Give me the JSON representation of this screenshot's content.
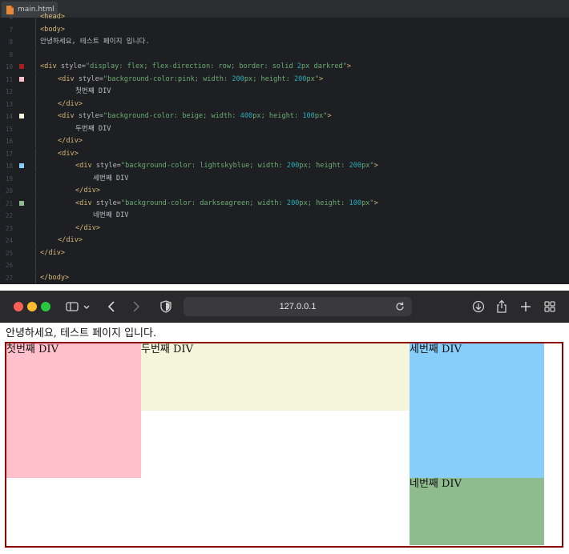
{
  "editor": {
    "tab": {
      "label": "main.html"
    },
    "lines": [
      {
        "n": "6",
        "text": "<head>",
        "partial": true
      },
      {
        "n": "7",
        "text": "<body>"
      },
      {
        "n": "8",
        "text": "안녕하세요, 테스트 페이지 입니다."
      },
      {
        "n": "9",
        "text": ""
      },
      {
        "n": "10",
        "text": "<div style=\"display: flex; flex-direction: row; border: solid 2px darkred\">",
        "marker": "#a61e1e"
      },
      {
        "n": "11",
        "text": "<div style=\"background-color:pink; width: 200px; height: 200px\">",
        "marker": "#ffc0cb"
      },
      {
        "n": "12",
        "text": "첫번째 DIV"
      },
      {
        "n": "13",
        "text": "</div>"
      },
      {
        "n": "14",
        "text": "<div style=\"background-color: beige; width: 400px; height: 100px\">",
        "marker": "#f5f5dc"
      },
      {
        "n": "15",
        "text": "두번째 DIV"
      },
      {
        "n": "16",
        "text": "</div>"
      },
      {
        "n": "17",
        "text": "<div>"
      },
      {
        "n": "18",
        "text": "<div style=\"background-color: lightskyblue; width: 200px; height: 200px\">",
        "marker": "#87cefa"
      },
      {
        "n": "19",
        "text": "세번째 DIV"
      },
      {
        "n": "20",
        "text": "</div>"
      },
      {
        "n": "21",
        "text": "<div style=\"background-color: darkseagreen; width: 200px; height: 100px\">",
        "marker": "#8fbc8f"
      },
      {
        "n": "22",
        "text": "네번째 DIV"
      },
      {
        "n": "23",
        "text": "</div>"
      },
      {
        "n": "24",
        "text": "</div>"
      },
      {
        "n": "25",
        "text": "</div>"
      },
      {
        "n": "26",
        "text": ""
      },
      {
        "n": "27",
        "text": "</body>"
      }
    ]
  },
  "browser": {
    "address": "127.0.0.1",
    "icons": [
      "sidebar-icon",
      "chevron-down-icon",
      "back-icon",
      "forward-icon",
      "shield-icon",
      "reload-icon",
      "download-icon",
      "share-icon",
      "new-tab-icon",
      "tab-overview-icon"
    ]
  },
  "page": {
    "greeting": "안녕하세요, 테스트 페이지 입니다.",
    "divs": [
      "첫번째 DIV",
      "두번째 DIV",
      "세번째 DIV",
      "네번째 DIV"
    ]
  }
}
